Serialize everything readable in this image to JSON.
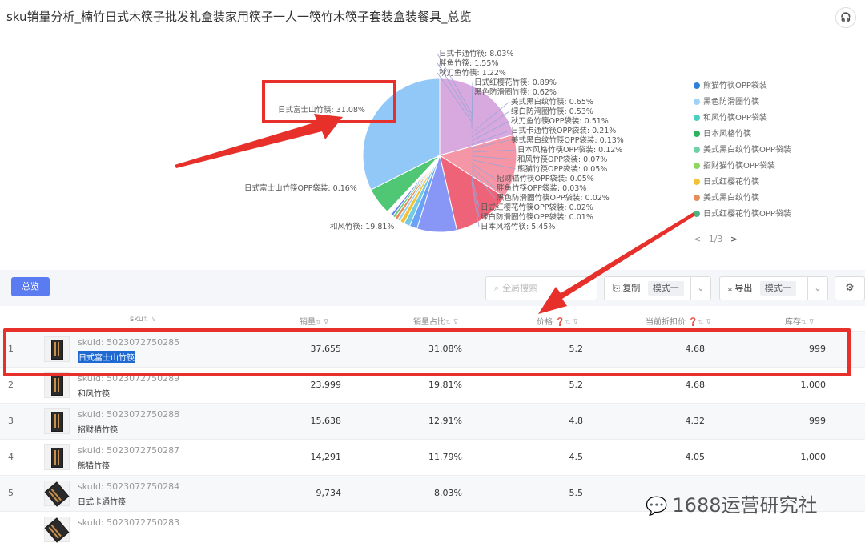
{
  "title": "sku销量分析_楠竹日式木筷子批发礼盒装家用筷子一人一筷竹木筷子套装盒装餐具_总览",
  "help_icon": "headset-icon",
  "pie": {
    "type": "pie",
    "slices": [
      {
        "name": "日式富士山竹筷",
        "label": "日式富士山竹筷: 31.08%",
        "value": 31.08,
        "color": "#91c8f8"
      },
      {
        "name": "和风竹筷",
        "label": "和风竹筷: 19.81%",
        "value": 19.81,
        "color": "#d8a9de"
      },
      {
        "name": "招财猫竹筷",
        "label": "",
        "value": 12.91,
        "color": "#f596a6"
      },
      {
        "name": "熊猫竹筷",
        "label": "",
        "value": 11.79,
        "color": "#ef6378"
      },
      {
        "name": "日式卡通竹筷",
        "label": "日式卡通竹筷: 8.03%",
        "value": 8.03,
        "color": "#8896f6"
      },
      {
        "name": "胖鱼竹筷",
        "label": "胖鱼竹筷: 1.55%",
        "value": 1.55,
        "color": "#6aa2f5"
      },
      {
        "name": "秋刀鱼竹筷",
        "label": "秋刀鱼竹筷: 1.22%",
        "value": 1.22,
        "color": "#74c9e3"
      },
      {
        "name": "日式红樱花竹筷",
        "label": "日式红樱花竹筷: 0.89%",
        "value": 0.89,
        "color": "#f1c232"
      },
      {
        "name": "黑色防滑圈竹筷",
        "label": "黑色防滑圈竹筷: 0.62%",
        "value": 0.62,
        "color": "#9fd2f7"
      },
      {
        "name": "美式黑白纹竹筷",
        "label": "美式黑白纹竹筷: 0.65%",
        "value": 0.65,
        "color": "#e58e57"
      },
      {
        "name": "绿白防滑圈竹筷",
        "label": "绿白防滑圈竹筷: 0.53%",
        "value": 0.53,
        "color": "#67c985"
      },
      {
        "name": "秋刀鱼竹筷OPP袋装",
        "label": "秋刀鱼竹筷OPP袋装: 0.51%",
        "value": 0.51,
        "color": "#5d7ef0"
      },
      {
        "name": "日式卡通竹筷OPP袋装",
        "label": "日式卡通竹筷OPP袋装: 0.21%",
        "value": 0.21,
        "color": "#b09cf0"
      },
      {
        "name": "日式富士山竹筷OPP袋装",
        "label": "日式富士山竹筷OPP袋装: 0.16%",
        "value": 0.16,
        "color": "#7fb1f5"
      },
      {
        "name": "美式黑白纹竹筷OPP袋装",
        "label": "美式黑白纹竹筷OPP袋装: 0.13%",
        "value": 0.13,
        "color": "#6fd0a7"
      },
      {
        "name": "日本风格竹筷OPP袋装",
        "label": "日本风格竹筷OPP袋装: 0.12%",
        "value": 0.12,
        "color": "#9aa0ef"
      },
      {
        "name": "和风竹筷OPP袋装",
        "label": "和风竹筷OPP袋装: 0.07%",
        "value": 0.07,
        "color": "#4ccfc3"
      },
      {
        "name": "熊猫竹筷OPP袋装",
        "label": "熊猫竹筷OPP袋装: 0.05%",
        "value": 0.05,
        "color": "#2f7fd8"
      },
      {
        "name": "招财猫竹筷OPP袋装",
        "label": "招财猫竹筷OPP袋装: 0.05%",
        "value": 0.05,
        "color": "#8fd65f"
      },
      {
        "name": "胖鱼竹筷OPP袋装",
        "label": "胖鱼竹筷OPP袋装: 0.03%",
        "value": 0.03,
        "color": "#c690e8"
      },
      {
        "name": "黑色防滑圈竹筷OPP袋装",
        "label": "黑色防滑圈竹筷OPP袋装: 0.02%",
        "value": 0.02,
        "color": "#a6c3e6"
      },
      {
        "name": "日式红樱花竹筷OPP袋装",
        "label": "日式红樱花竹筷OPP袋装: 0.02%",
        "value": 0.02,
        "color": "#4fb27e"
      },
      {
        "name": "绿白防滑圈竹筷OPP袋装",
        "label": "绿白防滑圈竹筷OPP袋装: 0.01%",
        "value": 0.01,
        "color": "#e6b3da"
      },
      {
        "name": "日本风格竹筷",
        "label": "日本风格竹筷: 5.45%",
        "value": 5.45,
        "color": "#4fc774"
      }
    ]
  },
  "legend": {
    "items": [
      {
        "label": "熊猫竹筷OPP袋装",
        "color": "#2f7fd8"
      },
      {
        "label": "黑色防滑圈竹筷",
        "color": "#9fd2f7"
      },
      {
        "label": "和风竹筷OPP袋装",
        "color": "#4ccfc3"
      },
      {
        "label": "日本风格竹筷",
        "color": "#2db35c"
      },
      {
        "label": "美式黑白纹竹筷OPP袋装",
        "color": "#6fd0a7"
      },
      {
        "label": "招财猫竹筷OPP袋装",
        "color": "#8fd65f"
      },
      {
        "label": "日式红樱花竹筷",
        "color": "#f1c232"
      },
      {
        "label": "美式黑白纹竹筷",
        "color": "#e58e57"
      },
      {
        "label": "日式红樱花竹筷OPP袋装",
        "color": "#4fb27e"
      }
    ],
    "prev": "<",
    "page": "1/3",
    "next": ">"
  },
  "toolbar": {
    "overview_label": "总览",
    "search_icon": "search-icon",
    "search_placeholder": "全局搜索",
    "copy_icon": "copy-icon",
    "copy_label": "复制",
    "copy_mode": "模式一",
    "export_icon": "export-icon",
    "export_label": "导出",
    "export_mode": "模式一",
    "settings_icon": "gear-icon"
  },
  "table": {
    "columns": [
      "sku",
      "销量",
      "销量占比",
      "价格",
      "当前折扣价",
      "库存"
    ],
    "rows": [
      {
        "idx": "1",
        "skuid": "skuId:  5023072750285",
        "name": "日式富士山竹筷",
        "sales": "37,655",
        "share": "31.08%",
        "price": "5.2",
        "discount": "4.68",
        "stock": "999"
      },
      {
        "idx": "2",
        "skuid": "skuId:  5023072750289",
        "name": "和风竹筷",
        "sales": "23,999",
        "share": "19.81%",
        "price": "5.2",
        "discount": "4.68",
        "stock": "1,000"
      },
      {
        "idx": "3",
        "skuid": "skuId:  5023072750288",
        "name": "招财猫竹筷",
        "sales": "15,638",
        "share": "12.91%",
        "price": "4.8",
        "discount": "4.32",
        "stock": "999"
      },
      {
        "idx": "4",
        "skuid": "skuId:  5023072750287",
        "name": "熊猫竹筷",
        "sales": "14,291",
        "share": "11.79%",
        "price": "4.5",
        "discount": "4.05",
        "stock": "1,000"
      },
      {
        "idx": "5",
        "skuid": "skuId:  5023072750284",
        "name": "日式卡通竹筷",
        "sales": "9,734",
        "share": "8.03%",
        "price": "5.5",
        "discount": "",
        "stock": ""
      },
      {
        "idx": "",
        "skuid": "skuId:  5023072750283",
        "name": "",
        "sales": "",
        "share": "",
        "price": "",
        "discount": "",
        "stock": ""
      }
    ]
  },
  "watermark": {
    "icon": "wechat-icon",
    "text": "1688运营研究社"
  },
  "colors": {
    "accent": "#5b7cf0",
    "annotation_red": "#e8302a",
    "selected_bg": "#1e69d2"
  }
}
